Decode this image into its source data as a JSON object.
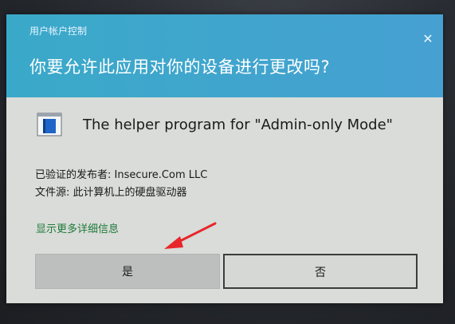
{
  "dialog": {
    "caption": "用户帐户控制",
    "question": "你要允许此应用对你的设备进行更改吗?",
    "close_icon": "close-icon",
    "app_icon": "program-window-icon",
    "app_name": "The helper program for \"Admin-only Mode\"",
    "publisher_line": "已验证的发布者: Insecure.Com LLC",
    "origin_line": "文件源: 此计算机上的硬盘驱动器",
    "more_details_link": "显示更多详细信息",
    "yes_label": "是",
    "no_label": "否",
    "colors": {
      "title_band": "#3fa6cc",
      "body": "#d9dcd8",
      "link": "#1f7a3a",
      "annotation_arrow": "#e8262a"
    }
  }
}
